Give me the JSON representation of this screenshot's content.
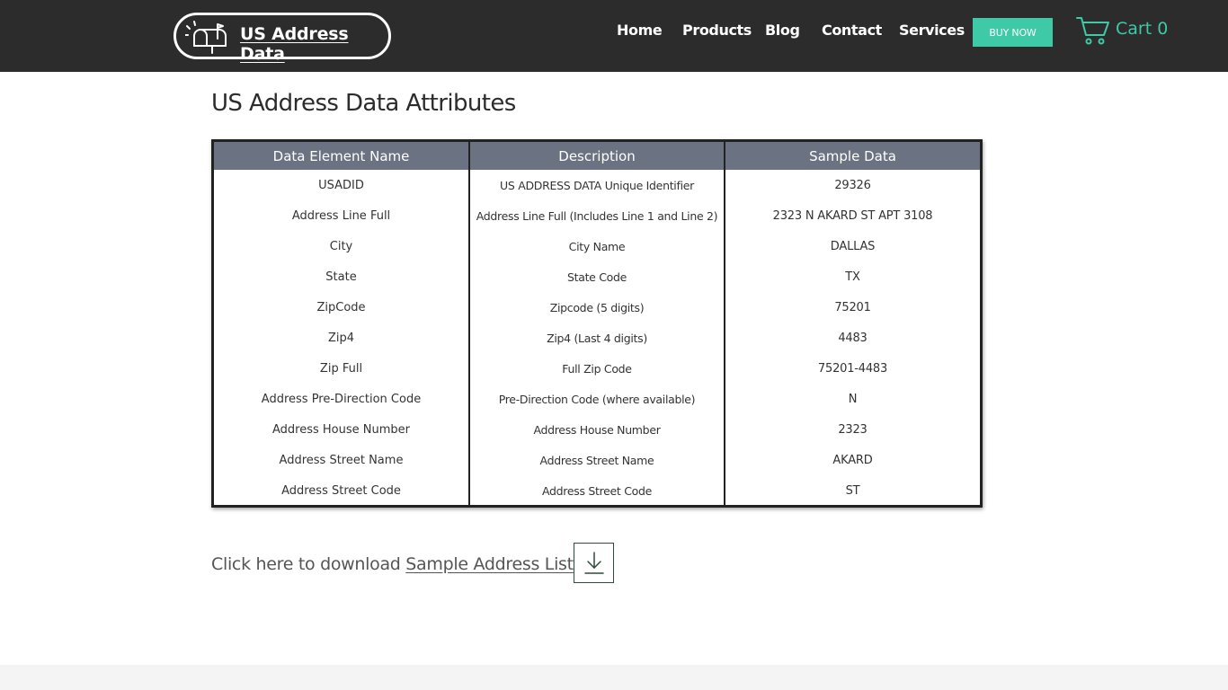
{
  "header": {
    "logo_text": "US Address Data",
    "nav": [
      "Home",
      "Products",
      "Blog",
      "Contact",
      "Services"
    ],
    "buy_now": "BUY NOW",
    "cart_label": "Cart",
    "cart_count": "0",
    "accent_color": "#3ec9a7",
    "icons": {
      "logo": "mailbox-icon",
      "cart": "cart-icon"
    }
  },
  "main": {
    "title": "US Address Data Attributes",
    "table": {
      "columns": [
        "Data Element Name",
        "Description",
        "Sample Data"
      ],
      "rows": [
        [
          "USADID",
          "US ADDRESS DATA Unique Identifier",
          "29326"
        ],
        [
          "Address Line Full",
          "Address Line Full (Includes Line 1 and Line 2)",
          "2323 N AKARD ST APT 3108"
        ],
        [
          "City",
          "City Name",
          "DALLAS"
        ],
        [
          "State",
          "State Code",
          "TX"
        ],
        [
          "ZipCode",
          "Zipcode (5 digits)",
          "75201"
        ],
        [
          "Zip4",
          "Zip4 (Last 4 digits)",
          "4483"
        ],
        [
          "Zip Full",
          "Full Zip Code",
          "75201-4483"
        ],
        [
          "Address Pre-Direction Code",
          "Pre-Direction Code (where available)",
          "N"
        ],
        [
          "Address House Number",
          "Address House Number",
          "2323"
        ],
        [
          "Address Street Name",
          "Address Street Name",
          "AKARD"
        ],
        [
          "Address Street Code",
          "Address Street Code",
          "ST"
        ]
      ]
    },
    "download": {
      "prefix": "Click here to download ",
      "link": "Sample Address List",
      "icon": "download-icon"
    }
  }
}
